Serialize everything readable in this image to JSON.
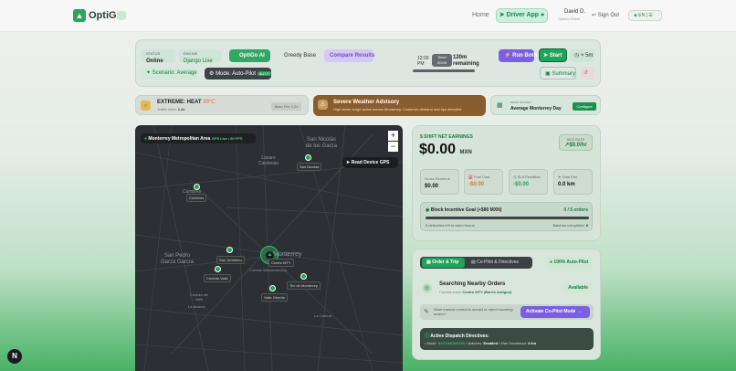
{
  "topbar": {
    "brand": "OptiGo",
    "home": "Home",
    "driver_app": "Driver App",
    "user_name": "David D.",
    "user_sub": "OptiGo Driver",
    "sign_out": "Sign Out",
    "lang": "EN"
  },
  "toolbar": {
    "status_label": "STATUS",
    "status_value": "Online",
    "engine_label": "ENGINE",
    "engine_value": "Django Live",
    "tabs": [
      "OptiGo AI",
      "Greedy Base",
      "Compare Results"
    ],
    "time": "12:00 PM",
    "timer_label": "Timer",
    "timer_value": "00:00",
    "remaining": "120m remaining",
    "run_label": "Run Both",
    "start_label": "Start",
    "speed": "× 5m",
    "scenario": "Scenario: Average",
    "mode": "Mode: Auto-Pilot",
    "mode_badge": "AUTO",
    "summary": "Summary"
  },
  "alerts": {
    "heat_title": "EXTREME: HEAT",
    "heat_temp": "39°C",
    "heat_sub": "Traffic index",
    "heat_index": "1.1x",
    "heat_fee": "Base Fee 1.2x",
    "weather_title": "Severe Weather Advisory",
    "weather_sub": "High storm surge active across Monterrey. Customer demand and tips elevated.",
    "dataset_label": "DEMO DATASET",
    "dataset_value": "Average Monterrey Day",
    "configure": "Configure"
  },
  "map": {
    "region": "Monterrey Metropolitan Area",
    "gps": "GPS Live • 60 FPS",
    "read_gps": "Read Device GPS",
    "labels": [
      "San Nicolás de los Garza",
      "Lázaro Cárdenas",
      "Cumbres",
      "San Pedro Garza García",
      "Monterrey",
      "Colonia Independencia",
      "Colonia del Valle",
      "La Alvarez",
      "La Carrera"
    ],
    "markers": [
      "San Nicolás",
      "Cumbres",
      "San Jerónimo",
      "Centrito Valle",
      "Centro MTY",
      "Tec de Monterrey",
      "Valle Oriente"
    ]
  },
  "earnings": {
    "title": "SHIFT NET EARNINGS",
    "amount": "$0.00",
    "unit": "MXN",
    "avg_label": "AVG RATE",
    "avg_value": "$0.0/hr",
    "gross_label": "Gross Revenue",
    "gross_value": "$0.00",
    "fuel_label": "Fuel Cost",
    "fuel_value": "-$0.00",
    "sla_label": "SLA Penalties",
    "sla_value": "-$0.00",
    "dist_label": "Total Dist",
    "dist_value": "0.0 km",
    "goal_title": "Block Incentive Goal (+$80 MXN)",
    "goal_count": "0 / 5 orders",
    "goal_progress": 0,
    "goal_left": "5 deliveries left to claim bonus",
    "batches_label": "Batches completed:",
    "batches_value": "0"
  },
  "dispatch": {
    "tab_order": "Order & Trip",
    "tab_copilot": "Co-Pilot & Directives",
    "auto_pilot": "100% Auto-Pilot",
    "search_title": "Searching Nearby Orders",
    "current_zone": "Current zone:",
    "zone_value": "Centro MTY (Barrio Antiguo)",
    "available": "Available",
    "manual_text": "Want manual control to accept or reject incoming orders?",
    "activate": "Activate Co-Pilot Mode",
    "directives_title": "Active Dispatch Directives:",
    "mode_text": "• Mode:",
    "mode_value": "AUTONOMOUS",
    "batch_text": "• Batches:",
    "batch_value": "Enabled",
    "dead_text": "• Max Deadhead:",
    "dead_value": "4 km"
  },
  "corner": {
    "badge": "N"
  },
  "colors": {
    "accent": "#1fa45a",
    "dark": "#2c2f33",
    "purple": "#6b4fd6"
  }
}
